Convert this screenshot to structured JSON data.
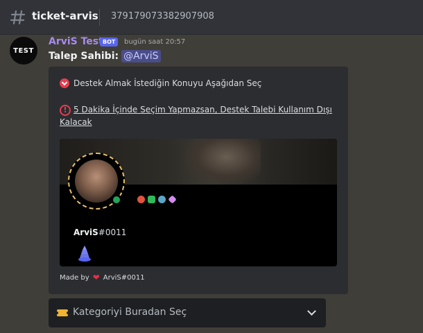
{
  "header": {
    "channel_icon": "hash-icon",
    "channel_name": "ticket-arvis",
    "channel_topic": "379179073382907908"
  },
  "message": {
    "avatar_text": "TEST",
    "username": "ArviS Test",
    "bot_badge": "BOT",
    "timestamp": "bugün saat 20:57",
    "owner_label": "Talep Sahibi:",
    "owner_mention": "@ArviS",
    "username_color": "#a68af0"
  },
  "embed": {
    "line1_icon": "red-down-arrow-icon",
    "line1": "Destek Almak İstediğin Konuyu Aşağıdan Seç",
    "line2_icon": "exclamation-icon",
    "line2": "5 Dakika İçinde Seçim Yapmazsan, Destek Talebi Kullanım Dışı Kalacak",
    "profile": {
      "name": "ArviS",
      "discriminator": "#0011",
      "status": "online",
      "badges": [
        "red-badge-icon",
        "green-badge-icon",
        "blue-badge-icon",
        "purple-badge-icon"
      ],
      "extra_icon": "cake-icon"
    },
    "footer_prefix": "Made by",
    "footer_icon": "heart-icon",
    "footer_author": "ArviS#0011"
  },
  "select_menu": {
    "icon": "ticket-icon",
    "placeholder": "Kategoriyi Buradan Seç"
  }
}
